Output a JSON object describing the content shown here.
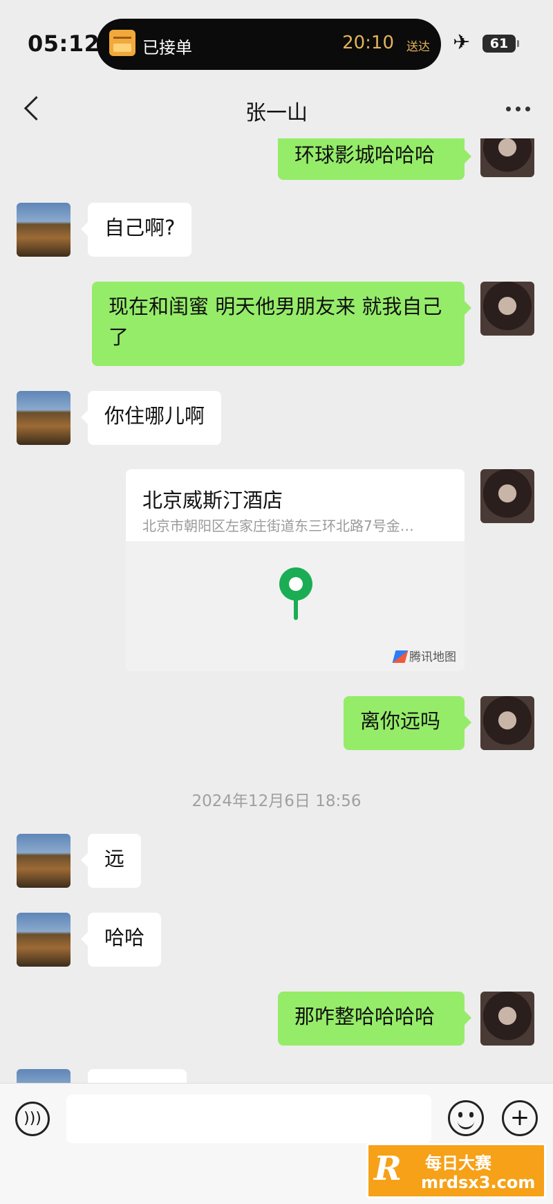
{
  "status_bar": {
    "time": "05:12",
    "island_title": "已接单",
    "island_time": "20:10",
    "island_suffix": "送达",
    "battery": "61"
  },
  "nav": {
    "title": "张一山"
  },
  "messages": {
    "m1": "环球影城哈哈哈",
    "m2": "自己啊?",
    "m3": "现在和闺蜜 明天他男朋友来 就我自己了",
    "m4": "你住哪儿啊",
    "location": {
      "name": "北京威斯汀酒店",
      "address": "北京市朝阳区左家庄街道东三环北路7号金…",
      "brand": "腾讯地图"
    },
    "m5": "离你远吗",
    "timestamp": "2024年12月6日 18:56",
    "m6": "远",
    "m7": "哈哈",
    "m8": "那咋整哈哈哈哈"
  },
  "input": {
    "value": "",
    "placeholder": ""
  },
  "watermark": {
    "cn": "每日大赛",
    "url": "mrdsx3.com"
  },
  "colors": {
    "outgoing_bubble": "#95ec69",
    "incoming_bubble": "#ffffff",
    "background": "#ededed"
  }
}
